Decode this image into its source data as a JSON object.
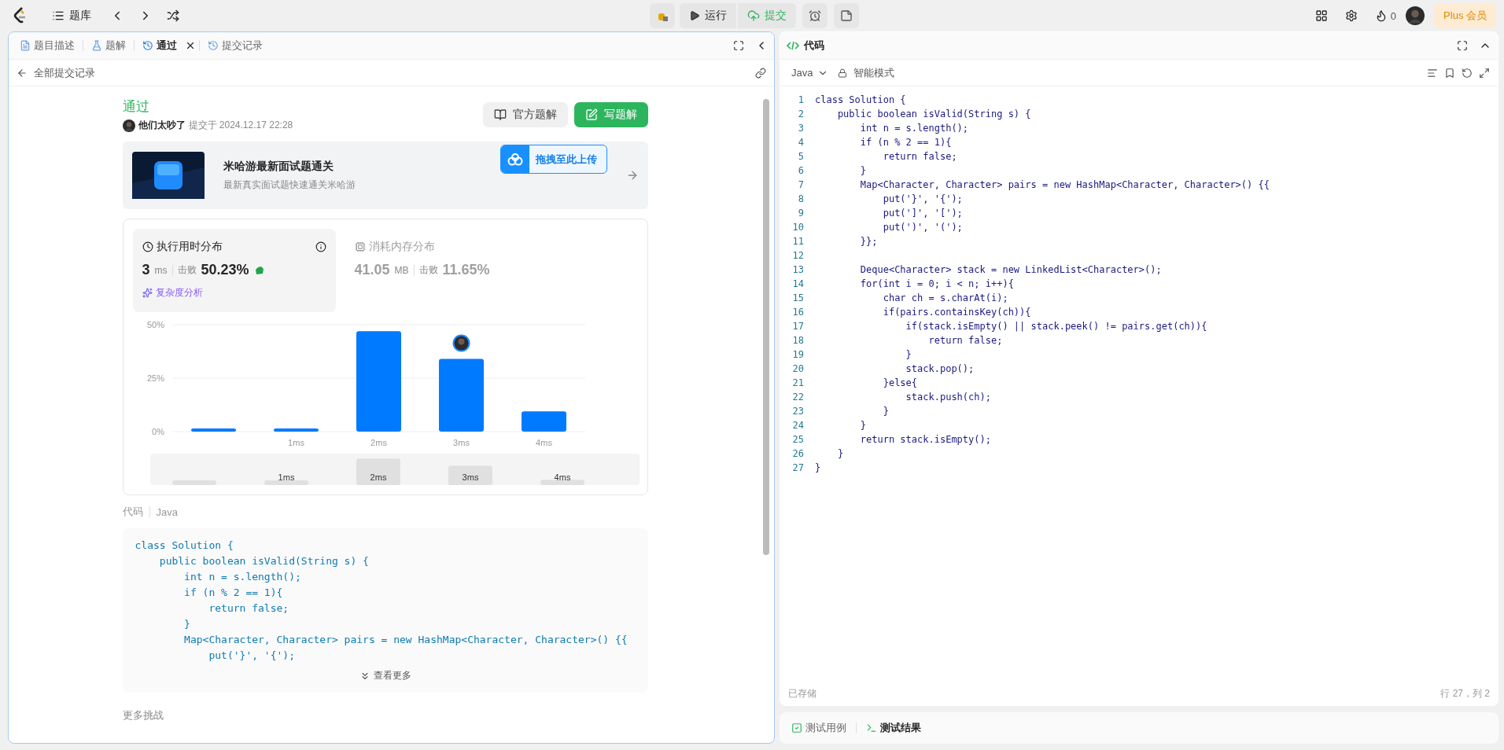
{
  "top_bar": {
    "problem_list": "题库",
    "run": "运行",
    "submit": "提交",
    "flame_count": "0",
    "plus": "Plus 会员"
  },
  "left_panel": {
    "tabs": [
      {
        "label": "题目描述",
        "selected": false,
        "closable": false
      },
      {
        "label": "题解",
        "selected": false,
        "closable": false
      },
      {
        "label": "通过",
        "selected": true,
        "closable": true
      },
      {
        "label": "提交记录",
        "selected": false,
        "closable": false
      }
    ],
    "back_link": "全部提交记录",
    "result": {
      "status": "通过",
      "user": "他们太吵了",
      "submitted": "提交于 2024.12.17 22:28",
      "solution_button": "官方题解",
      "write_button": "写题解"
    },
    "banner": {
      "kind": "picture",
      "title": "米哈游最新面试题通关",
      "subtitle": "最新真实面试题快速通关米哈游",
      "upload": "拖拽至此上传"
    },
    "runtime": {
      "title": "执行用时分布",
      "value": "3",
      "unit": "ms",
      "beats_label": "击败",
      "beats": "50.23%",
      "analysis": "复杂度分析",
      "selected": true
    },
    "memory": {
      "title": "消耗内存分布",
      "value": "41.05",
      "unit": "MB",
      "beats_label": "击败",
      "beats": "11.65%",
      "selected": false
    },
    "chart_data": {
      "type": "bar",
      "categories": [
        null,
        "1ms",
        "2ms",
        "3ms",
        "4ms"
      ],
      "series": [
        {
          "color": "#007aff",
          "values": [
            1.5,
            1.5,
            47,
            34,
            9.5
          ]
        }
      ],
      "ylim": [
        0,
        50
      ],
      "yticks": [
        {
          "value": 0,
          "label": "0%"
        },
        {
          "value": 25,
          "label": "25%"
        },
        {
          "value": 50,
          "label": "50%"
        }
      ]
    },
    "overview_labels": [
      "1ms",
      "2ms",
      "3ms",
      "4ms"
    ],
    "code_label": "代码",
    "code_lang": "Java",
    "code_lines": [
      "class Solution {",
      "    public boolean isValid(String s) {",
      "        int n = s.length();",
      "        if (n % 2 == 1){",
      "            return false;",
      "        }",
      "        Map<Character, Character> pairs = new HashMap<Character, Character>() {{",
      "            put('}', '{');"
    ],
    "show_more": "查看更多",
    "more_challenges": "更多挑战"
  },
  "editor": {
    "title": "代码",
    "language": "Java",
    "mode": "智能模式",
    "lines": [
      {
        "number": "1",
        "text": "class Solution {"
      },
      {
        "number": "2",
        "text": "    public boolean isValid(String s) {"
      },
      {
        "number": "3",
        "text": "        int n = s.length();"
      },
      {
        "number": "4",
        "text": "        if (n % 2 == 1){"
      },
      {
        "number": "5",
        "text": "            return false;"
      },
      {
        "number": "6",
        "text": "        }"
      },
      {
        "number": "7",
        "text": "        Map<Character, Character> pairs = new HashMap<Character, Character>() {{"
      },
      {
        "number": "8",
        "text": "            put('}', '{');"
      },
      {
        "number": "9",
        "text": "            put(']', '[');"
      },
      {
        "number": "10",
        "text": "            put(')', '(');"
      },
      {
        "number": "11",
        "text": "        }};"
      },
      {
        "number": "12"
      },
      {
        "number": "13",
        "text": "        Deque<Character> stack = new LinkedList<Character>();"
      },
      {
        "number": "14",
        "text": "        for(int i = 0; i < n; i++){"
      },
      {
        "number": "15",
        "text": "            char ch = s.charAt(i);"
      },
      {
        "number": "16",
        "text": "            if(pairs.containsKey(ch)){"
      },
      {
        "number": "17",
        "text": "                if(stack.isEmpty() || stack.peek() != pairs.get(ch)){"
      },
      {
        "number": "18",
        "text": "                    return false;"
      },
      {
        "number": "19",
        "text": "                }"
      },
      {
        "number": "20",
        "text": "                stack.pop();"
      },
      {
        "number": "21",
        "text": "            }else{"
      },
      {
        "number": "22",
        "text": "                stack.push(ch);"
      },
      {
        "number": "23",
        "text": "            }"
      },
      {
        "number": "24",
        "text": "        }"
      },
      {
        "number": "25",
        "text": "        return stack.isEmpty();"
      },
      {
        "number": "26",
        "text": "    }"
      },
      {
        "number": "27",
        "text": "}"
      }
    ],
    "saved": "已存储",
    "cursor": "行 27，列 2"
  },
  "bottom_tabs": [
    {
      "label": "测试用例",
      "selected": false
    },
    {
      "label": "测试结果",
      "selected": true
    }
  ]
}
